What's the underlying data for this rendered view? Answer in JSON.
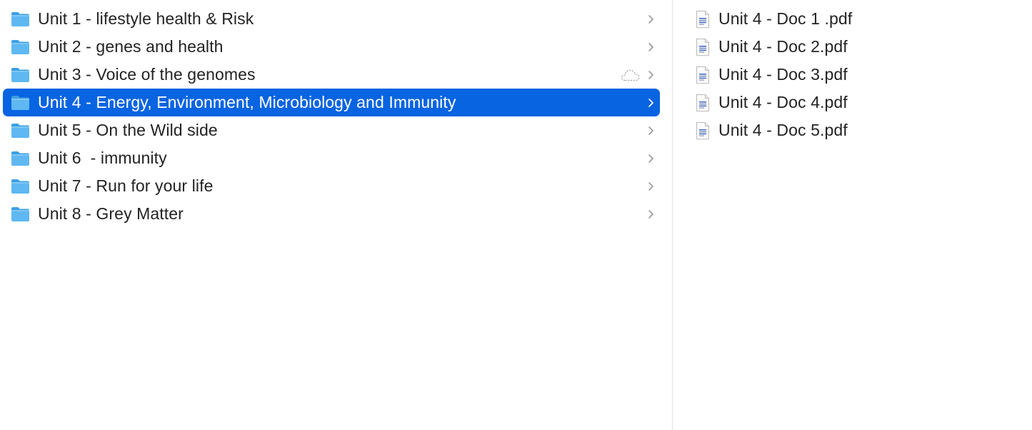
{
  "folders": [
    {
      "label": "Unit 1 - lifestyle health & Risk",
      "selected": false,
      "cloud": false
    },
    {
      "label": "Unit 2 - genes and health",
      "selected": false,
      "cloud": false
    },
    {
      "label": "Unit 3 - Voice of the genomes",
      "selected": false,
      "cloud": true
    },
    {
      "label": "Unit 4 - Energy, Environment, Microbiology and Immunity",
      "selected": true,
      "cloud": false
    },
    {
      "label": "Unit 5 - On the Wild side",
      "selected": false,
      "cloud": false
    },
    {
      "label": "Unit 6  - immunity",
      "selected": false,
      "cloud": false
    },
    {
      "label": "Unit 7 - Run for your life",
      "selected": false,
      "cloud": false
    },
    {
      "label": "Unit 8 - Grey Matter",
      "selected": false,
      "cloud": false
    }
  ],
  "files": [
    {
      "label": "Unit 4 - Doc 1 .pdf"
    },
    {
      "label": "Unit 4 - Doc 2.pdf"
    },
    {
      "label": "Unit 4 - Doc 3.pdf"
    },
    {
      "label": "Unit 4 - Doc 4.pdf"
    },
    {
      "label": "Unit 4 - Doc 5.pdf"
    }
  ],
  "icons": {
    "folder": "folder-icon",
    "file": "pdf-file-icon",
    "chevron": "chevron-right-icon",
    "cloud": "icloud-download-icon"
  },
  "colors": {
    "selection": "#0864e1",
    "folder_body": "#5fb8f2",
    "folder_tab": "#3c9fe4",
    "text": "#232323",
    "selected_text": "#ffffff",
    "chevron": "#9a9a9a"
  }
}
